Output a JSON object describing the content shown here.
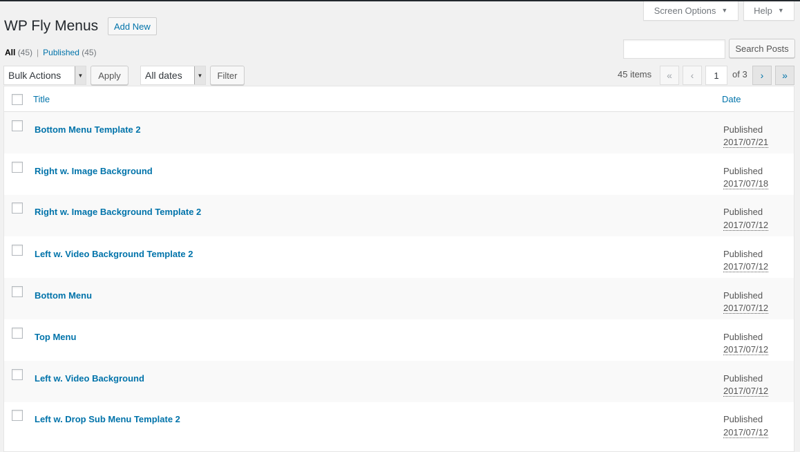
{
  "header": {
    "screen_options_label": "Screen Options",
    "help_label": "Help",
    "page_title": "WP Fly Menus",
    "add_new_label": "Add New"
  },
  "views": {
    "all_label": "All",
    "all_count": "(45)",
    "separator": "|",
    "published_label": "Published",
    "published_count": "(45)"
  },
  "search": {
    "value": "",
    "button_label": "Search Posts"
  },
  "tablenav": {
    "bulk_actions": {
      "selected": "Bulk Actions"
    },
    "apply_label": "Apply",
    "dates": {
      "selected": "All dates"
    },
    "filter_label": "Filter",
    "items_count": "45 items",
    "first_page": "«",
    "prev_page": "‹",
    "current_page": "1",
    "total_pages": "of 3",
    "next_page": "›",
    "last_page": "»"
  },
  "table": {
    "columns": {
      "title": "Title",
      "date": "Date"
    },
    "rows": [
      {
        "title": "Bottom Menu Template 2",
        "status": "Published",
        "date": "2017/07/21"
      },
      {
        "title": "Right w. Image Background",
        "status": "Published",
        "date": "2017/07/18"
      },
      {
        "title": "Right w. Image Background Template 2",
        "status": "Published",
        "date": "2017/07/12"
      },
      {
        "title": "Left w. Video Background Template 2",
        "status": "Published",
        "date": "2017/07/12"
      },
      {
        "title": "Bottom Menu",
        "status": "Published",
        "date": "2017/07/12"
      },
      {
        "title": "Top Menu",
        "status": "Published",
        "date": "2017/07/12"
      },
      {
        "title": "Left w. Video Background",
        "status": "Published",
        "date": "2017/07/12"
      },
      {
        "title": "Left w. Drop Sub Menu Template 2",
        "status": "Published",
        "date": "2017/07/12"
      }
    ]
  },
  "colors": {
    "link": "#0073aa",
    "background": "#f1f1f1",
    "admin_bar": "#23282d"
  }
}
